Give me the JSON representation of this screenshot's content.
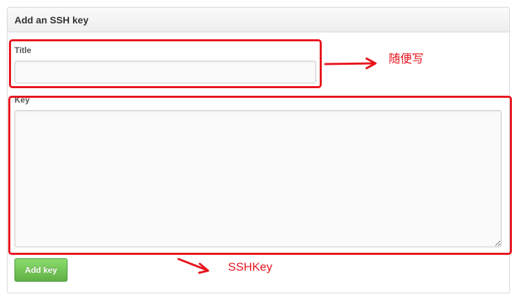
{
  "panel": {
    "title": "Add an SSH key"
  },
  "form": {
    "title_label": "Title",
    "title_value": "",
    "key_label": "Key",
    "key_value": "",
    "submit_label": "Add key"
  },
  "annotations": {
    "title_note": "随便写",
    "key_note": "SSHKey",
    "color": "#e8141d"
  },
  "colors": {
    "button_green": "#60b044",
    "header_bg": "#f2f2f2"
  }
}
